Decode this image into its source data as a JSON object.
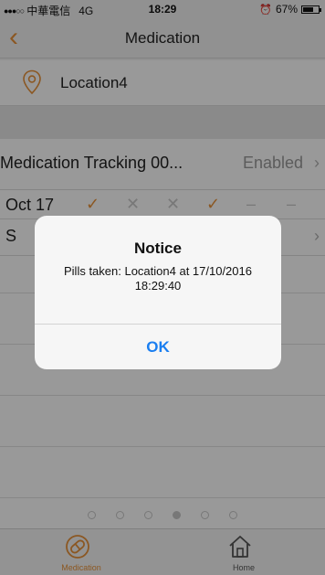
{
  "status_bar": {
    "signal": "●●●○○",
    "carrier": "中華電信",
    "network": "4G",
    "time": "18:29",
    "battery_text": "67%",
    "battery_level": 0.67
  },
  "nav": {
    "title": "Medication"
  },
  "location": {
    "label": "Location4"
  },
  "tracking": {
    "title": "Medication Tracking 00...",
    "status": "Enabled",
    "day_label": "Oct  17",
    "marks": [
      "✓",
      "✕",
      "✕",
      "✓",
      "–",
      "–"
    ],
    "row3_label": "S"
  },
  "pager": {
    "count": 6,
    "active_index": 3
  },
  "tabs": [
    {
      "label": "Medication",
      "icon": "pill-icon",
      "active": true
    },
    {
      "label": "Home",
      "icon": "home-icon",
      "active": false
    }
  ],
  "alert": {
    "title": "Notice",
    "message": "Pills taken: Location4 at 17/10/2016 18:29:40",
    "ok_label": "OK"
  },
  "colors": {
    "accent": "#e8923a",
    "link": "#1a7ef0"
  }
}
